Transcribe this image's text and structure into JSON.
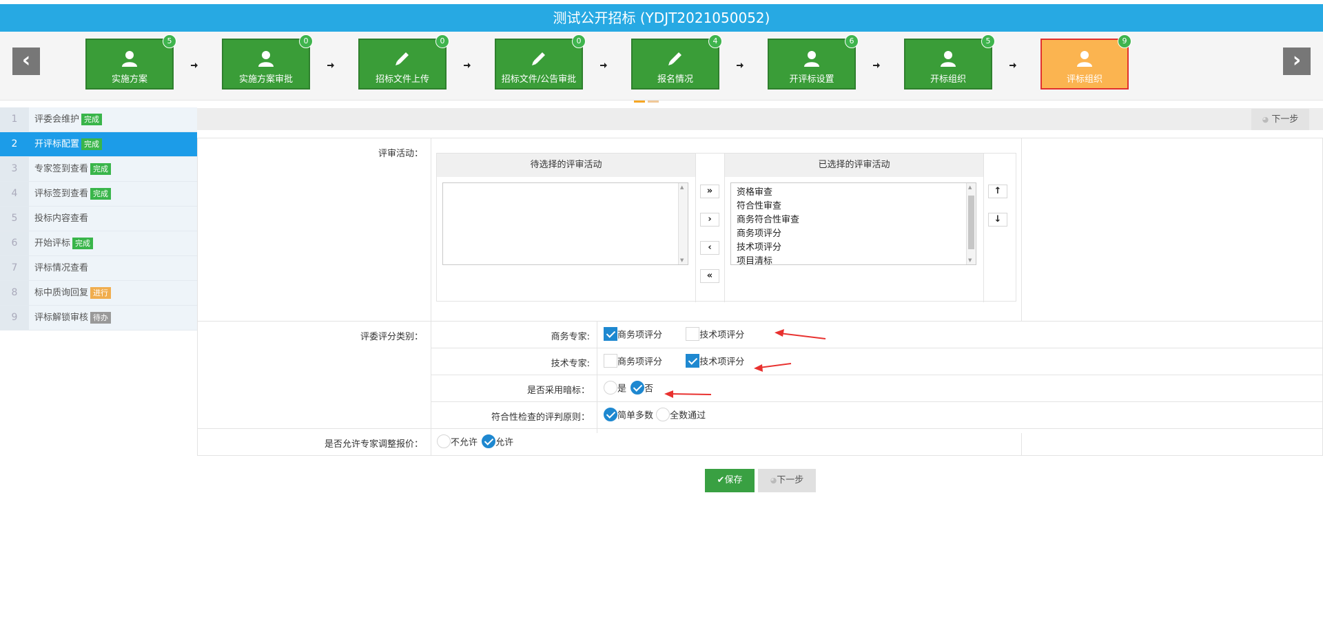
{
  "header": {
    "title": "测试公开招标 (YDJT2021050052)"
  },
  "steps": [
    {
      "label": "实施方案",
      "count": "5",
      "icon": "user-icon"
    },
    {
      "label": "实施方案审批",
      "count": "0",
      "icon": "user-icon"
    },
    {
      "label": "招标文件上传",
      "count": "0",
      "icon": "pencil-icon"
    },
    {
      "label": "招标文件/公告审批",
      "count": "0",
      "icon": "pencil-icon"
    },
    {
      "label": "报名情况",
      "count": "4",
      "icon": "pencil-icon"
    },
    {
      "label": "开评标设置",
      "count": "6",
      "icon": "user-icon"
    },
    {
      "label": "开标组织",
      "count": "5",
      "icon": "user-icon"
    },
    {
      "label": "评标组织",
      "count": "9",
      "icon": "user-icon"
    }
  ],
  "sidebar": {
    "items": [
      {
        "num": "1",
        "label": "评委会维护",
        "tag": "完成",
        "status": "done"
      },
      {
        "num": "2",
        "label": "开评标配置",
        "tag": "完成",
        "status": "done"
      },
      {
        "num": "3",
        "label": "专家签到查看",
        "tag": "完成",
        "status": "done"
      },
      {
        "num": "4",
        "label": "评标签到查看",
        "tag": "完成",
        "status": "done"
      },
      {
        "num": "5",
        "label": "投标内容查看",
        "tag": "",
        "status": ""
      },
      {
        "num": "6",
        "label": "开始评标",
        "tag": "完成",
        "status": "done"
      },
      {
        "num": "7",
        "label": "评标情况查看",
        "tag": "",
        "status": ""
      },
      {
        "num": "8",
        "label": "标中质询回复",
        "tag": "进行",
        "status": "doing"
      },
      {
        "num": "9",
        "label": "评标解锁审核",
        "tag": "待办",
        "status": "todo"
      }
    ]
  },
  "toolbar": {
    "next_label": "下一步"
  },
  "form": {
    "activity_label": "评审活动：",
    "available_header": "待选择的评审活动",
    "selected_header": "已选择的评审活动",
    "selected_items": [
      "资格审查",
      "符合性审查",
      "商务符合性审查",
      "商务项评分",
      "技术项评分",
      "项目清标"
    ],
    "category_label": "评委评分类别：",
    "business_expert_label": "商务专家:",
    "tech_expert_label": "技术专家:",
    "business_score_label": "商务项评分",
    "tech_score_label": "技术项评分",
    "blind_label": "是否采用暗标：",
    "blind_yes": "是",
    "blind_no": "否",
    "principle_label": "符合性检查的评判原则：",
    "principle_simple": "简单多数",
    "principle_all": "全数通过",
    "adjust_label": "是否允许专家调整报价：",
    "adjust_no": "不允许",
    "adjust_yes": "允许"
  },
  "footer": {
    "save_label": "保存",
    "next_label": "下一步"
  },
  "colors": {
    "topbar": "#27a9e3",
    "step_green": "#3a9d38",
    "step_active": "#fbb450",
    "sidebar_active": "#1c9ce8",
    "check_blue": "#1e88d0"
  }
}
